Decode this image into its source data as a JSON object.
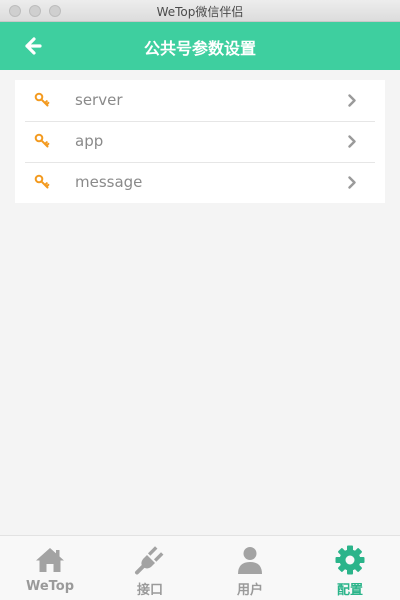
{
  "window": {
    "title": "WeTop微信伴侣"
  },
  "header": {
    "title": "公共号参数设置",
    "back_icon": "arrow-left-icon"
  },
  "settings_list": {
    "icon": "key-icon",
    "icon_color": "#f39a1f",
    "items": [
      {
        "label": "server"
      },
      {
        "label": "app"
      },
      {
        "label": "message"
      }
    ]
  },
  "tabbar": {
    "active_color": "#2bb48a",
    "inactive_color": "#9a9a9a",
    "tabs": [
      {
        "label": "WeTop",
        "icon": "home-icon",
        "active": false
      },
      {
        "label": "接口",
        "icon": "plug-icon",
        "active": false
      },
      {
        "label": "用户",
        "icon": "user-icon",
        "active": false
      },
      {
        "label": "配置",
        "icon": "gear-icon",
        "active": true
      }
    ]
  },
  "theme": {
    "accent": "#3ecf9f"
  }
}
